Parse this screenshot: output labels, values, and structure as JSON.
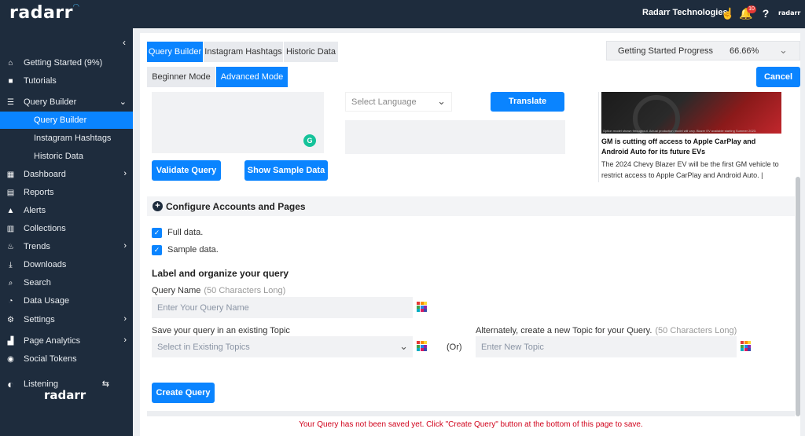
{
  "brand": {
    "name": "radarr",
    "small_name": "radarr"
  },
  "topbar": {
    "company": "Radarr Technologies",
    "notifications": "10",
    "icons": [
      "hand-point-icon",
      "bell-icon",
      "help-icon"
    ]
  },
  "sidebar": {
    "items": [
      {
        "label": "Getting Started (9%)",
        "icon": "home-icon"
      },
      {
        "label": "Tutorials",
        "icon": "video-icon"
      },
      {
        "label": "Query Builder",
        "icon": "database-icon"
      },
      {
        "label": "Query Builder"
      },
      {
        "label": "Instagram Hashtags"
      },
      {
        "label": "Historic Data"
      },
      {
        "label": "Dashboard",
        "icon": "grid-icon"
      },
      {
        "label": "Reports",
        "icon": "file-icon"
      },
      {
        "label": "Alerts",
        "icon": "warning-icon"
      },
      {
        "label": "Collections",
        "icon": "collections-icon"
      },
      {
        "label": "Trends",
        "icon": "fire-icon"
      },
      {
        "label": "Downloads",
        "icon": "download-icon"
      },
      {
        "label": "Search",
        "icon": "search-icon"
      },
      {
        "label": "Data Usage",
        "icon": "gauge-icon"
      },
      {
        "label": "Settings",
        "icon": "gear-icon"
      },
      {
        "label": "Page Analytics",
        "icon": "analytics-icon"
      },
      {
        "label": "Social Tokens",
        "icon": "token-icon"
      },
      {
        "label": "Listening",
        "icon": "ear-icon"
      }
    ]
  },
  "tabs": [
    "Query Builder",
    "Instagram Hashtags",
    "Historic Data"
  ],
  "modes": [
    "Beginner Mode",
    "Advanced Mode"
  ],
  "progress": {
    "label": "Getting Started Progress",
    "value": "66.66%"
  },
  "buttons": {
    "cancel": "Cancel",
    "translate": "Translate",
    "validate": "Validate Query",
    "sample": "Show Sample Data",
    "create": "Create Query"
  },
  "language_select": {
    "placeholder": "Select Language"
  },
  "news": {
    "caption": "Option model shown throughout. Actual production model will vary. Blazer EV available starting Summer 2023.",
    "title": "GM is cutting off access to Apple CarPlay and Android Auto for its future EVs",
    "text": "The 2024 Chevy Blazer EV will be the first GM vehicle to restrict access to Apple CarPlay and Android Auto. | Image:"
  },
  "config": {
    "title": "Configure Accounts and Pages"
  },
  "checkboxes": [
    "Full data.",
    "Sample data."
  ],
  "form": {
    "section": "Label and organize your query",
    "query_name_label": "Query Name",
    "query_name_hint": "(50 Characters Long)",
    "query_name_placeholder": "Enter Your Query Name",
    "topic_label": "Save your query in an existing Topic",
    "topic_placeholder": "Select in Existing Topics",
    "or": "(Or)",
    "new_topic_label": "Alternately, create a new Topic for your Query.",
    "new_topic_hint": "(50 Characters Long)",
    "new_topic_placeholder": "Enter New Topic"
  },
  "footer": {
    "message": "Your Query has not been saved yet. Click \"Create Query\" button at the bottom of this page to save."
  },
  "colors": {
    "accent": "#0a84ff",
    "sidebar": "#1e2c3d",
    "alert": "#d0021b"
  }
}
